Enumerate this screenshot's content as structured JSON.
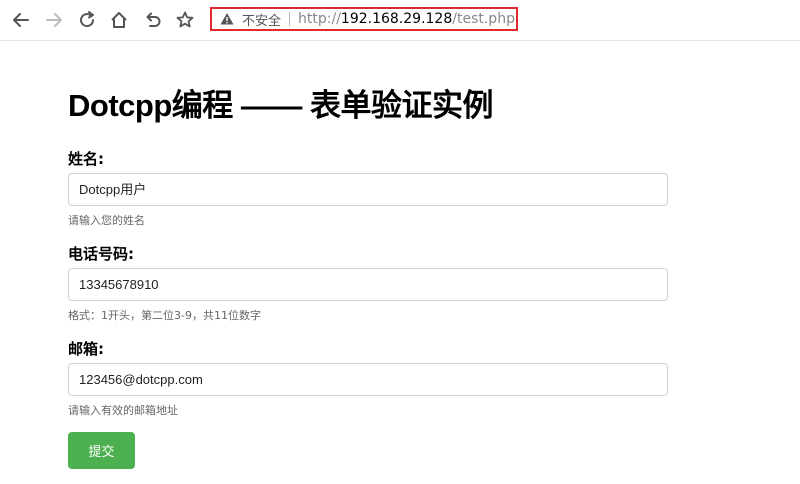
{
  "browser": {
    "security_label": "不安全",
    "url_scheme": "http://",
    "url_host": "192.168.29.128",
    "url_path": "/test.php",
    "highlight_color": "#e02a2f"
  },
  "page": {
    "title": "Dotcpp编程 —— 表单验证实例",
    "fields": [
      {
        "label": "姓名:",
        "value": "Dotcpp用户",
        "hint": "请输入您的姓名"
      },
      {
        "label": "电话号码:",
        "value": "13345678910",
        "hint": "格式：1开头，第二位3-9，共11位数字"
      },
      {
        "label": "邮箱:",
        "value": "123456@dotcpp.com",
        "hint": "请输入有效的邮箱地址"
      }
    ],
    "submit_label": "提交",
    "submit_color": "#4caf50"
  }
}
